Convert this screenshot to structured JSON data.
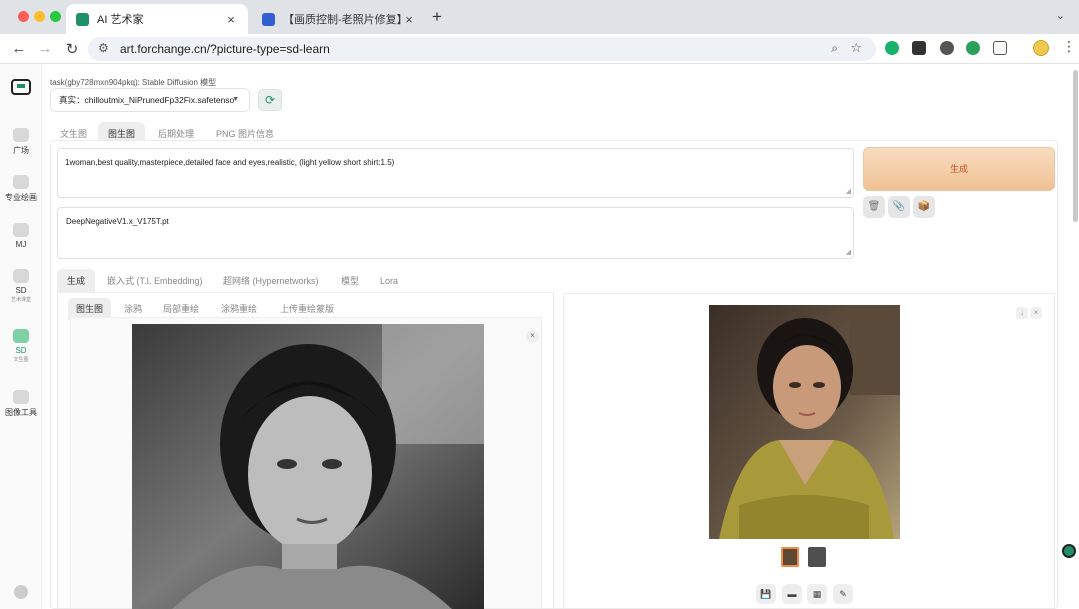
{
  "browser": {
    "tabs": [
      {
        "title": "AI 艺术家",
        "close": "×"
      },
      {
        "title": "【画质控制-老照片修复】案例",
        "close": "×"
      }
    ],
    "new_tab": "+",
    "tab_search": "⌄",
    "url": "art.forchange.cn/?picture-type=sd-learn",
    "nav": {
      "back": "←",
      "forward": "→",
      "reload": "↻"
    }
  },
  "app": {
    "task_label": "task(gby728mxn904pkq): Stable Diffusion 模型",
    "model": {
      "prefix": "真实：",
      "value": "chilloutmix_NiPrunedFp32Fix.safetenso"
    },
    "sidebar": [
      {
        "label": "广场",
        "sub": ""
      },
      {
        "label": "专业绘画",
        "sub": ""
      },
      {
        "label": "MJ",
        "sub": ""
      },
      {
        "label": "SD",
        "sub": "艺术课堂"
      },
      {
        "label": "SD",
        "sub": "文生图"
      },
      {
        "label": "图像工具",
        "sub": ""
      }
    ],
    "main_tabs": [
      "文生图",
      "图生图",
      "后期处理",
      "PNG 图片信息"
    ],
    "prompt": "1woman,best quality,masterpiece,detailed face and eyes,realistic, (light yellow short shirt:1.5)",
    "negative_prompt": "DeepNegativeV1.x_V175T.pt",
    "generate_label": "生成",
    "sub_tabs": [
      "生成",
      "嵌入式 (T.I. Embedding)",
      "超网络 (Hypernetworks)",
      "模型",
      "Lora"
    ],
    "img_tabs": [
      "图生图",
      "涂鸦",
      "局部重绘",
      "涂鸦重绘",
      "上传重绘蒙版"
    ]
  },
  "colors": {
    "accent": "#1f8f6a",
    "generate_bg": "#f4cfa6",
    "generate_text": "#c0522a"
  }
}
